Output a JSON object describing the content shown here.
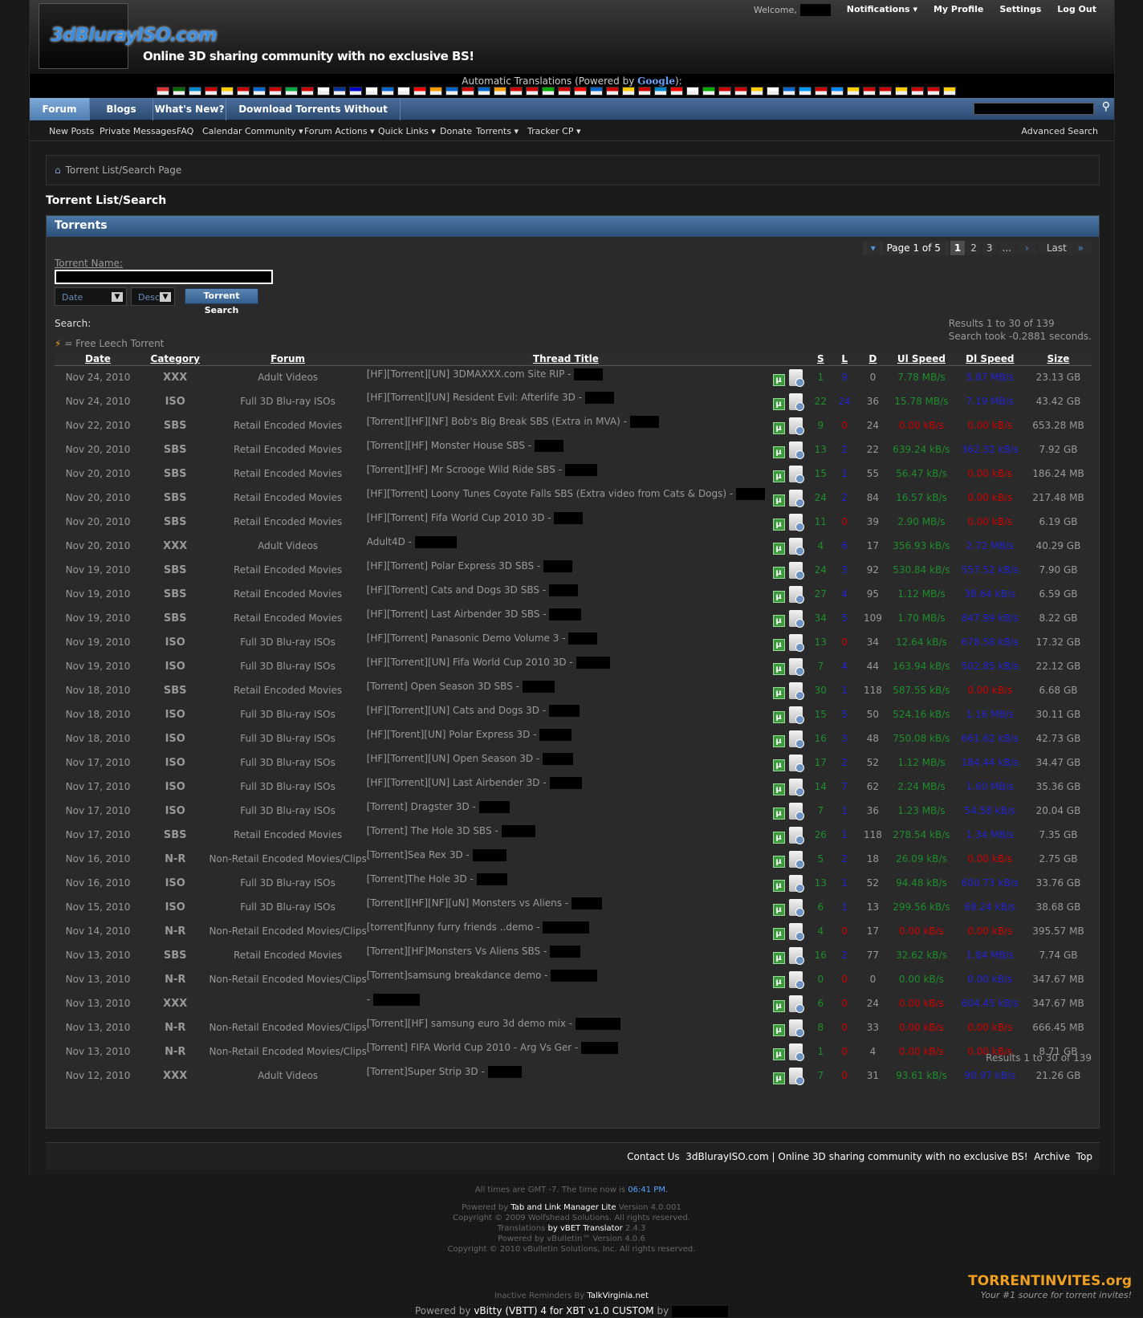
{
  "header": {
    "logo_text": "3dBlurayISO.com",
    "slogan": "Online 3D sharing community with no exclusive BS!",
    "welcome": "Welcome,",
    "top_links": [
      "Notifications",
      "My Profile",
      "Settings",
      "Log Out"
    ]
  },
  "translate": {
    "label": "Automatic Translations (Powered by",
    "google": "Google",
    "suffix": "):"
  },
  "nav": {
    "tabs": [
      "Forum",
      "Blogs",
      "What's New?",
      "Download Torrents Without Seeding!"
    ],
    "sub": [
      "New Posts",
      "Private Messages",
      "FAQ",
      "Calendar",
      "Community",
      "Forum Actions",
      "Quick Links",
      "Donate",
      "Torrents",
      "Tracker CP"
    ],
    "advanced_search": "Advanced Search"
  },
  "breadcrumb": "Torrent List/Search Page",
  "page_title": "Torrent List/Search",
  "panel": {
    "title": "Torrents",
    "pager": {
      "label": "Page 1 of 5",
      "pages": [
        "1",
        "2",
        "3"
      ],
      "ellipsis": "...",
      "last": "Last"
    },
    "torrent_name_label": "Torrent Name:",
    "sort_field": "Date",
    "sort_order": "Desc",
    "search_button": "Torrent Search",
    "search_label": "Search:",
    "results_line1": "Results 1 to 30 of 139",
    "results_line2": "Search took -0.2881 seconds.",
    "legend": "= Free Leech Torrent",
    "results_bottom": "Results 1 to 30 of 139"
  },
  "columns": [
    "Date",
    "Category",
    "Forum",
    "Thread Title",
    "S",
    "L",
    "D",
    "Ul Speed",
    "Dl Speed",
    "Size"
  ],
  "rows": [
    {
      "date": "Nov 24, 2010",
      "cat": "XXX",
      "forum": "Adult Videos",
      "title": "[HF][Torrent][UN] 3DMAXXX.com Site RIP -",
      "rw": 36,
      "s": "1",
      "l": "9",
      "d": "0",
      "ul": "7.78 MB/s",
      "ulc": "green",
      "dl": "5.87 MB/s",
      "dlc": "blue",
      "size": "23.13 GB"
    },
    {
      "date": "Nov 24, 2010",
      "cat": "ISO",
      "forum": "Full 3D Blu-ray ISOs",
      "title": "[HF][Torrent][UN] Resident Evil: Afterlife 3D -",
      "rw": 36,
      "s": "22",
      "l": "24",
      "d": "36",
      "ul": "15.78 MB/s",
      "ulc": "green",
      "dl": "7.19 MB/s",
      "dlc": "blue",
      "size": "43.42 GB"
    },
    {
      "date": "Nov 22, 2010",
      "cat": "SBS",
      "forum": "Retail Encoded Movies",
      "title": "[Torrent][HF][NF] Bob's Big Break SBS (Extra in MVA) -",
      "rw": 36,
      "s": "9",
      "l": "0",
      "d": "24",
      "ul": "0.00 kB/s",
      "ulc": "red",
      "dl": "0.00 kB/s",
      "dlc": "red",
      "size": "653.28 MB"
    },
    {
      "date": "Nov 20, 2010",
      "cat": "SBS",
      "forum": "Retail Encoded Movies",
      "title": "[Torrent][HF] Monster House SBS -",
      "rw": 36,
      "s": "13",
      "l": "2",
      "d": "22",
      "ul": "639.24 kB/s",
      "ulc": "green",
      "dl": "362.32 kB/s",
      "dlc": "blue",
      "size": "7.92 GB"
    },
    {
      "date": "Nov 20, 2010",
      "cat": "SBS",
      "forum": "Retail Encoded Movies",
      "title": "[Torrent][HF] Mr Scrooge Wild Ride SBS -",
      "rw": 40,
      "s": "15",
      "l": "1",
      "d": "55",
      "ul": "56.47 kB/s",
      "ulc": "green",
      "dl": "0.00 kB/s",
      "dlc": "red",
      "size": "186.24 MB"
    },
    {
      "date": "Nov 20, 2010",
      "cat": "SBS",
      "forum": "Retail Encoded Movies",
      "title": "[HF][Torrent] Loony Tunes Coyote Falls SBS (Extra video from Cats & Dogs) -",
      "rw": 36,
      "s": "24",
      "l": "2",
      "d": "84",
      "ul": "16.57 kB/s",
      "ulc": "green",
      "dl": "0.00 kB/s",
      "dlc": "red",
      "size": "217.48 MB"
    },
    {
      "date": "Nov 20, 2010",
      "cat": "SBS",
      "forum": "Retail Encoded Movies",
      "title": "[HF][Torrent] Fifa World Cup 2010 3D -",
      "rw": 36,
      "s": "11",
      "l": "0",
      "d": "39",
      "ul": "2.90 MB/s",
      "ulc": "green",
      "dl": "0.00 kB/s",
      "dlc": "red",
      "size": "6.19 GB"
    },
    {
      "date": "Nov 20, 2010",
      "cat": "XXX",
      "forum": "Adult Videos",
      "title": "Adult4D -",
      "rw": 52,
      "s": "4",
      "l": "6",
      "d": "17",
      "ul": "356.93 kB/s",
      "ulc": "green",
      "dl": "2.72 MB/s",
      "dlc": "blue",
      "size": "40.29 GB"
    },
    {
      "date": "Nov 19, 2010",
      "cat": "SBS",
      "forum": "Retail Encoded Movies",
      "title": "[HF][Torrent] Polar Express 3D SBS -",
      "rw": 36,
      "s": "24",
      "l": "3",
      "d": "92",
      "ul": "530.84 kB/s",
      "ulc": "green",
      "dl": "557.52 kB/s",
      "dlc": "blue",
      "size": "7.90 GB"
    },
    {
      "date": "Nov 19, 2010",
      "cat": "SBS",
      "forum": "Retail Encoded Movies",
      "title": "[HF][Torrent] Cats and Dogs 3D SBS -",
      "rw": 36,
      "s": "27",
      "l": "4",
      "d": "95",
      "ul": "1.12 MB/s",
      "ulc": "green",
      "dl": "38.64 kB/s",
      "dlc": "blue",
      "size": "6.59 GB"
    },
    {
      "date": "Nov 19, 2010",
      "cat": "SBS",
      "forum": "Retail Encoded Movies",
      "title": "[HF][Torrent] Last Airbender 3D SBS -",
      "rw": 40,
      "s": "34",
      "l": "5",
      "d": "109",
      "ul": "1.70 MB/s",
      "ulc": "green",
      "dl": "847.99 kB/s",
      "dlc": "blue",
      "size": "8.22 GB"
    },
    {
      "date": "Nov 19, 2010",
      "cat": "ISO",
      "forum": "Full 3D Blu-ray ISOs",
      "title": "[HF][Torrent] Panasonic Demo Volume 3 -",
      "rw": 36,
      "s": "13",
      "l": "0",
      "d": "34",
      "ul": "12.64 kB/s",
      "ulc": "green",
      "dl": "678.58 kB/s",
      "dlc": "blue",
      "size": "17.32 GB"
    },
    {
      "date": "Nov 19, 2010",
      "cat": "ISO",
      "forum": "Full 3D Blu-ray ISOs",
      "title": "[HF][Torrent][UN] Fifa World Cup 2010 3D -",
      "rw": 42,
      "s": "7",
      "l": "4",
      "d": "44",
      "ul": "163.94 kB/s",
      "ulc": "green",
      "dl": "502.85 kB/s",
      "dlc": "blue",
      "size": "22.12 GB"
    },
    {
      "date": "Nov 18, 2010",
      "cat": "SBS",
      "forum": "Retail Encoded Movies",
      "title": "[Torrent] Open Season 3D SBS -",
      "rw": 40,
      "s": "30",
      "l": "1",
      "d": "118",
      "ul": "587.55 kB/s",
      "ulc": "green",
      "dl": "0.00 kB/s",
      "dlc": "red",
      "size": "6.68 GB"
    },
    {
      "date": "Nov 18, 2010",
      "cat": "ISO",
      "forum": "Full 3D Blu-ray ISOs",
      "title": "[HF][Torrent][UN] Cats and Dogs 3D -",
      "rw": 38,
      "s": "15",
      "l": "5",
      "d": "50",
      "ul": "524.16 kB/s",
      "ulc": "green",
      "dl": "1.16 MB/s",
      "dlc": "blue",
      "size": "30.11 GB"
    },
    {
      "date": "Nov 18, 2010",
      "cat": "ISO",
      "forum": "Full 3D Blu-ray ISOs",
      "title": "[HF][Torent][UN] Polar Express 3D -",
      "rw": 40,
      "s": "16",
      "l": "3",
      "d": "48",
      "ul": "750.08 kB/s",
      "ulc": "green",
      "dl": "661.62 kB/s",
      "dlc": "blue",
      "size": "42.73 GB"
    },
    {
      "date": "Nov 17, 2010",
      "cat": "ISO",
      "forum": "Full 3D Blu-ray ISOs",
      "title": "[HF][Torrent][UN] Open Season 3D -",
      "rw": 38,
      "s": "17",
      "l": "2",
      "d": "52",
      "ul": "1.12 MB/s",
      "ulc": "green",
      "dl": "184.44 kB/s",
      "dlc": "blue",
      "size": "34.47 GB"
    },
    {
      "date": "Nov 17, 2010",
      "cat": "ISO",
      "forum": "Full 3D Blu-ray ISOs",
      "title": "[HF][Torrent][UN] Last Airbender 3D -",
      "rw": 40,
      "s": "14",
      "l": "7",
      "d": "62",
      "ul": "2.24 MB/s",
      "ulc": "green",
      "dl": "1.60 MB/s",
      "dlc": "blue",
      "size": "35.36 GB"
    },
    {
      "date": "Nov 17, 2010",
      "cat": "ISO",
      "forum": "Full 3D Blu-ray ISOs",
      "title": "[Torrent] Dragster 3D -",
      "rw": 38,
      "s": "7",
      "l": "1",
      "d": "36",
      "ul": "1.23 MB/s",
      "ulc": "green",
      "dl": "54.58 kB/s",
      "dlc": "blue",
      "size": "20.04 GB"
    },
    {
      "date": "Nov 17, 2010",
      "cat": "SBS",
      "forum": "Retail Encoded Movies",
      "title": "[Torrent] The Hole 3D SBS -",
      "rw": 42,
      "s": "26",
      "l": "1",
      "d": "118",
      "ul": "278.54 kB/s",
      "ulc": "green",
      "dl": "1.34 MB/s",
      "dlc": "blue",
      "size": "7.35 GB"
    },
    {
      "date": "Nov 16, 2010",
      "cat": "N-R",
      "forum": "Non-Retail Encoded Movies/Clips",
      "title": "[Torrent]Sea Rex 3D -",
      "rw": 42,
      "s": "5",
      "l": "2",
      "d": "18",
      "ul": "26.09 kB/s",
      "ulc": "green",
      "dl": "0.00 kB/s",
      "dlc": "red",
      "size": "2.75 GB"
    },
    {
      "date": "Nov 16, 2010",
      "cat": "ISO",
      "forum": "Full 3D Blu-ray ISOs",
      "title": "[Torrent]The Hole 3D -",
      "rw": 38,
      "s": "13",
      "l": "1",
      "d": "52",
      "ul": "94.48 kB/s",
      "ulc": "green",
      "dl": "600.73 kB/s",
      "dlc": "blue",
      "size": "33.76 GB"
    },
    {
      "date": "Nov 15, 2010",
      "cat": "ISO",
      "forum": "Full 3D Blu-ray ISOs",
      "title": "[Torrent][HF][NF][uN] Monsters vs Aliens -",
      "rw": 38,
      "s": "6",
      "l": "1",
      "d": "13",
      "ul": "299.56 kB/s",
      "ulc": "green",
      "dl": "68.24 kB/s",
      "dlc": "blue",
      "size": "38.68 GB"
    },
    {
      "date": "Nov 14, 2010",
      "cat": "N-R",
      "forum": "Non-Retail Encoded Movies/Clips",
      "title": "[torrent]funny furry friends ..demo -",
      "rw": 58,
      "s": "4",
      "l": "0",
      "d": "17",
      "ul": "0.00 kB/s",
      "ulc": "red",
      "dl": "0.00 kB/s",
      "dlc": "red",
      "size": "395.57 MB"
    },
    {
      "date": "Nov 13, 2010",
      "cat": "SBS",
      "forum": "Retail Encoded Movies",
      "title": "[Torrent][HF]Monsters Vs Aliens SBS -",
      "rw": 38,
      "s": "16",
      "l": "2",
      "d": "77",
      "ul": "32.62 kB/s",
      "ulc": "green",
      "dl": "1.84 MB/s",
      "dlc": "blue",
      "size": "7.74 GB"
    },
    {
      "date": "Nov 13, 2010",
      "cat": "N-R",
      "forum": "Non-Retail Encoded Movies/Clips",
      "title": "[Torrent]samsung breakdance demo -",
      "rw": 58,
      "s": "0",
      "l": "0",
      "d": "0",
      "ul": "0.00 kB/s",
      "ulc": "green",
      "dl": "0.00 kB/s",
      "dlc": "blue",
      "size": "347.67 MB"
    },
    {
      "date": "Nov 13, 2010",
      "cat": "XXX",
      "forum": "",
      "title": " -",
      "rw": 58,
      "s": "6",
      "l": "0",
      "d": "24",
      "ul": "0.00 kB/s",
      "ulc": "red",
      "dl": "604.45 kB/s",
      "dlc": "blue",
      "size": "347.67 MB"
    },
    {
      "date": "Nov 13, 2010",
      "cat": "N-R",
      "forum": "Non-Retail Encoded Movies/Clips",
      "title": "[Torrent][HF] samsung euro 3d demo mix -",
      "rw": 56,
      "s": "8",
      "l": "0",
      "d": "33",
      "ul": "0.00 kB/s",
      "ulc": "red",
      "dl": "0.00 kB/s",
      "dlc": "red",
      "size": "666.45 MB"
    },
    {
      "date": "Nov 13, 2010",
      "cat": "N-R",
      "forum": "Non-Retail Encoded Movies/Clips",
      "title": "[Torrent] FIFA World Cup 2010 - Arg Vs Ger -",
      "rw": 46,
      "s": "1",
      "l": "0",
      "d": "4",
      "ul": "0.00 kB/s",
      "ulc": "red",
      "dl": "0.00 kB/s",
      "dlc": "red",
      "size": "8.71 GB"
    },
    {
      "date": "Nov 12, 2010",
      "cat": "XXX",
      "forum": "Adult Videos",
      "title": "[Torrent]Super Strip 3D -",
      "rw": 42,
      "s": "7",
      "l": "0",
      "d": "31",
      "ul": "93.61 kB/s",
      "ulc": "green",
      "dl": "90.97 kB/s",
      "dlc": "blue",
      "size": "21.26 GB"
    }
  ],
  "footer": {
    "links": [
      "Contact Us",
      "3dBlurayISO.com",
      "|",
      "Online 3D sharing community with no exclusive BS!",
      "Archive",
      "Top"
    ],
    "timezone": "All times are GMT -7. The time now is",
    "time": "06:41 PM.",
    "credits": [
      [
        "Powered by ",
        "Tab and Link Manager Lite",
        " Version 4.0.001"
      ],
      [
        "Copyright © 2009 Wolfshead Solutions. All rights reserved.",
        "",
        ""
      ],
      [
        "Translations ",
        "by vBET Translator",
        " 2.4.3"
      ],
      [
        "Powered by vBulletin™ Version 4.0.6",
        "",
        ""
      ],
      [
        "Copyright © 2010 vBulletin Solutions, Inc. All rights reserved.",
        "",
        ""
      ]
    ],
    "inactive": "Inactive Reminders By",
    "inactive_link": "TalkVirginia.net",
    "vbitty_prefix": "Powered by",
    "vbitty": "vBitty (VBTT) 4 for XBT v1.0 CUSTOM",
    "vbitty_by": "by",
    "ti_logo": "TORRENTINVITES.org",
    "ti_sub": "Your #1 source for torrent invites!"
  }
}
